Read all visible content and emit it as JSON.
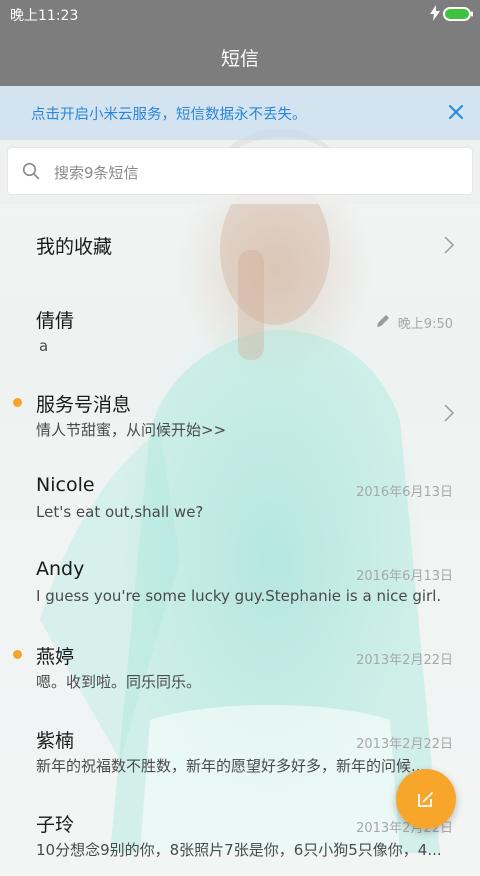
{
  "status_bar": {
    "time": "晚上11:23"
  },
  "app_bar": {
    "title": "短信"
  },
  "banner": {
    "text": "点击开启小米云服务，短信数据永不丢失。"
  },
  "search": {
    "placeholder": "搜索9条短信"
  },
  "list": {
    "items": [
      {
        "name": "我的收藏",
        "preview": "",
        "date": "",
        "unread": false,
        "chevron": true,
        "draft": false
      },
      {
        "name": "倩倩",
        "preview": "a",
        "date": "晚上9:50",
        "unread": false,
        "chevron": false,
        "draft": true
      },
      {
        "name": "服务号消息",
        "preview": "情人节甜蜜，从问候开始>>",
        "date": "",
        "unread": true,
        "chevron": true,
        "draft": false
      },
      {
        "name": "Nicole",
        "preview": "Let's eat out,shall we?",
        "date": "2016年6月13日",
        "unread": false,
        "chevron": false,
        "draft": false
      },
      {
        "name": "Andy",
        "preview": "I guess you're some lucky guy.Stephanie is a nice girl.",
        "date": "2016年6月13日",
        "unread": false,
        "chevron": false,
        "draft": false
      },
      {
        "name": "燕婷",
        "preview": "嗯。收到啦。同乐同乐。",
        "date": "2013年2月22日",
        "unread": true,
        "chevron": false,
        "draft": false
      },
      {
        "name": "紫楠",
        "preview": "新年的祝福数不胜数，新年的愿望好多好多，新年的问候...",
        "date": "2013年2月22日",
        "unread": false,
        "chevron": false,
        "draft": false
      },
      {
        "name": "子玲",
        "preview": "10分想念9别的你，8张照片7张是你，6只小狗5只像你，4...",
        "date": "2013年2月22日",
        "unread": false,
        "chevron": false,
        "draft": false
      }
    ]
  },
  "fab": {
    "icon": "compose-icon"
  },
  "colors": {
    "accent": "#f8a52b",
    "banner_text": "#2a86d8",
    "bar": "#7d7d7d",
    "unread_dot": "#f7a32a"
  }
}
